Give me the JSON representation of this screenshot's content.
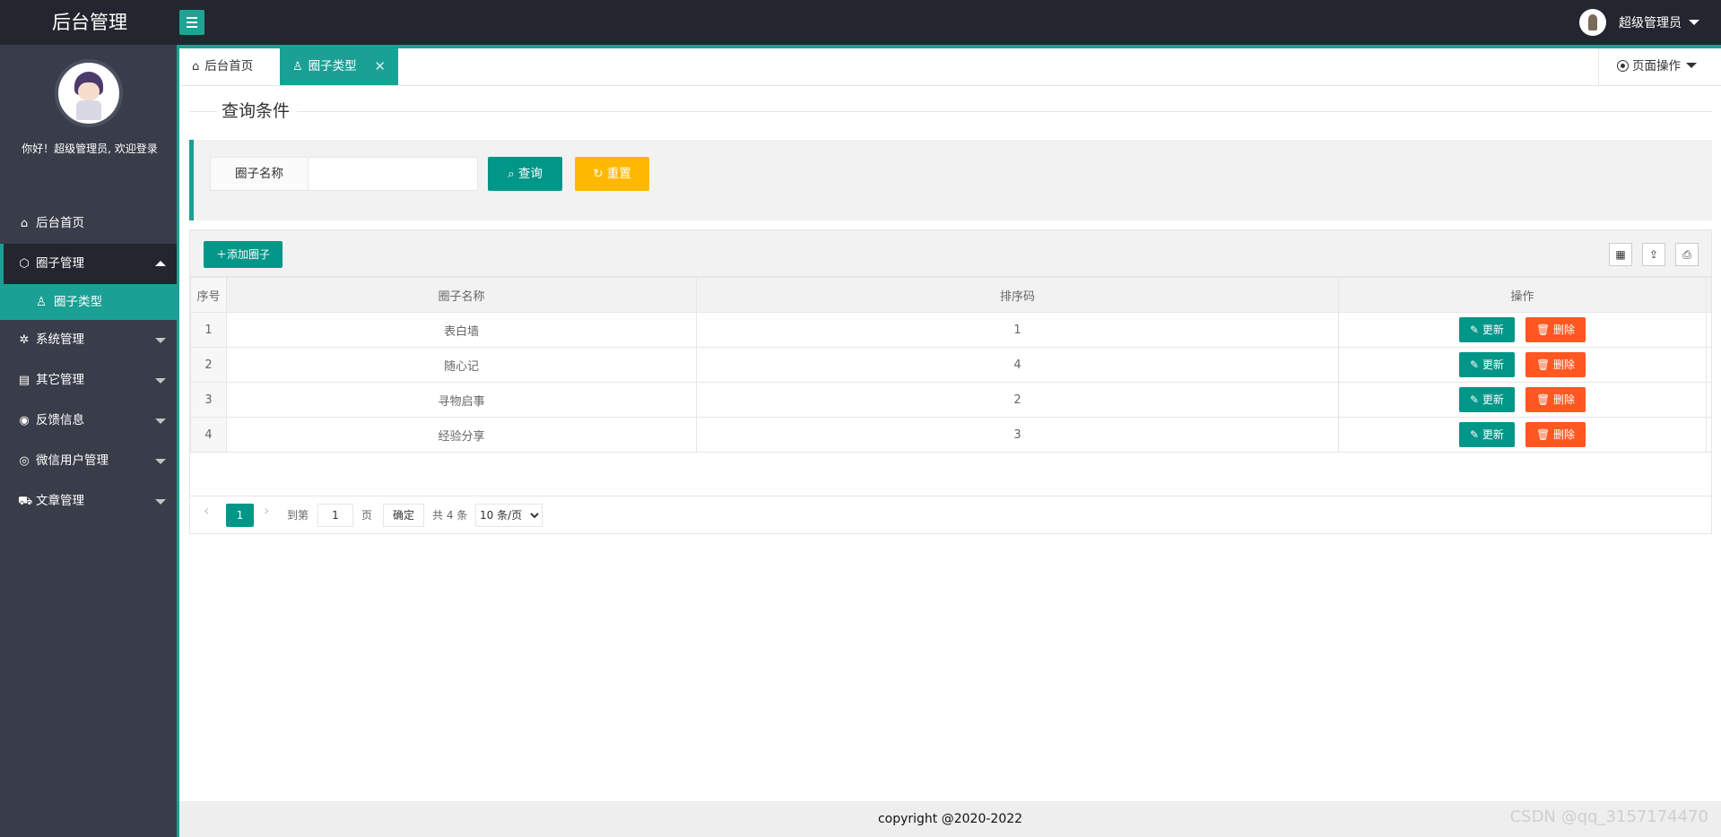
{
  "header": {
    "logo": "后台管理",
    "username": "超级管理员"
  },
  "sidebar": {
    "welcome": "你好！超级管理员, 欢迎登录",
    "items": [
      {
        "label": "后台首页",
        "icon": "home-icon"
      },
      {
        "label": "圈子管理",
        "icon": "cube-icon"
      },
      {
        "label": "圈子类型",
        "icon": "user-icon"
      },
      {
        "label": "系统管理",
        "icon": "gear-icon"
      },
      {
        "label": "其它管理",
        "icon": "clipboard-icon"
      },
      {
        "label": "反馈信息",
        "icon": "feedback-icon"
      },
      {
        "label": "微信用户管理",
        "icon": "pause-circle-icon"
      },
      {
        "label": "文章管理",
        "icon": "cart-icon"
      }
    ]
  },
  "tabs": {
    "home": "后台首页",
    "active": "圈子类型",
    "close": "✕",
    "page_ops": "页面操作"
  },
  "search": {
    "section_title": "查询条件",
    "label": "圈子名称",
    "value": "",
    "query_button": "查询",
    "reset_button": "重置"
  },
  "table": {
    "add_button": "添加圈子",
    "columns": [
      "序号",
      "圈子名称",
      "排序码",
      "操作"
    ],
    "rows": [
      {
        "no": "1",
        "name": "表白墙",
        "sort": "1"
      },
      {
        "no": "2",
        "name": "随心记",
        "sort": "4"
      },
      {
        "no": "3",
        "name": "寻物启事",
        "sort": "2"
      },
      {
        "no": "4",
        "name": "经验分享",
        "sort": "3"
      }
    ],
    "edit_label": "更新",
    "delete_label": "删除"
  },
  "pagination": {
    "current_page": "1",
    "goto_text": "到第",
    "page_input": "1",
    "page_unit": "页",
    "confirm": "确定",
    "total": "共 4 条",
    "page_size": "10 条/页"
  },
  "footer": {
    "copyright": "copyright @2020-2022",
    "watermark": "CSDN @qq_3157174470"
  },
  "colors": {
    "accent": "#009688",
    "sidebar_bg": "#393d49",
    "header_bg": "#23262e",
    "reset": "#ffb800",
    "delete": "#ff5722"
  }
}
